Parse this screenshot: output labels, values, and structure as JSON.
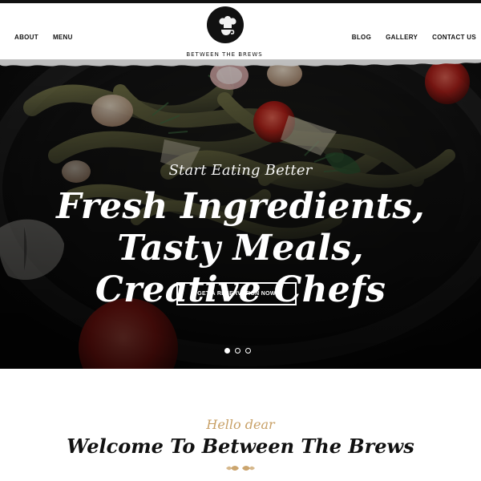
{
  "nav": {
    "left": [
      {
        "label": "ABOUT"
      },
      {
        "label": "MENU"
      }
    ],
    "right": [
      {
        "label": "BLOG"
      },
      {
        "label": "GALLERY"
      },
      {
        "label": "CONTACT US"
      }
    ]
  },
  "brand": {
    "name": "BETWEEN THE BREWS",
    "logo_icon": "chef-logo-icon"
  },
  "hero": {
    "eyebrow": "Start Eating Better",
    "headline_line1": "Fresh Ingredients, Tasty Meals,",
    "headline_line2": "Creative Chefs",
    "cta_label": "GET A RESERVATION NOW",
    "carousel": {
      "slides": 3,
      "active": 1
    }
  },
  "welcome": {
    "hello": "Hello dear",
    "title": "Welcome To Between The Brews",
    "ornament_icon": "wheat-ornament-icon"
  },
  "colors": {
    "accent": "#c8a066",
    "dark": "#111111",
    "hero_text": "#ffffff"
  }
}
